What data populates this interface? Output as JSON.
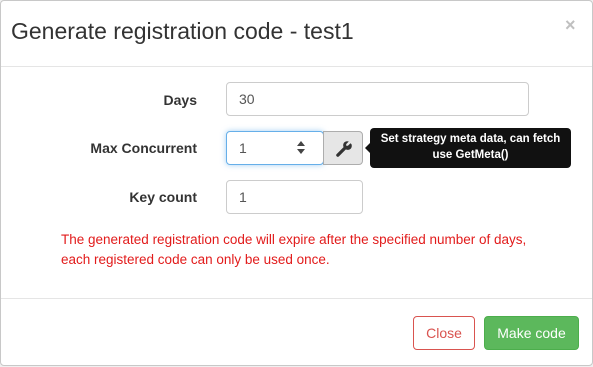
{
  "dialog": {
    "title": "Generate registration code - test1",
    "close_glyph": "×"
  },
  "form": {
    "days": {
      "label": "Days",
      "value": "30"
    },
    "max_concurrent": {
      "label": "Max Concurrent",
      "value": "1"
    },
    "key_count": {
      "label": "Key count",
      "value": "1"
    },
    "tool_icon": "wrench-icon",
    "tooltip": "Set strategy meta data, can fetch use GetMeta()",
    "help_text": "The generated registration code will expire after the specified number of days, each registered code can only be used once."
  },
  "footer": {
    "close_label": "Close",
    "make_label": "Make code"
  },
  "colors": {
    "danger": "#d9534f",
    "success": "#5cb85c",
    "help_text": "#e21b1b",
    "tooltip_bg": "#111111",
    "focus": "#66afe9"
  }
}
